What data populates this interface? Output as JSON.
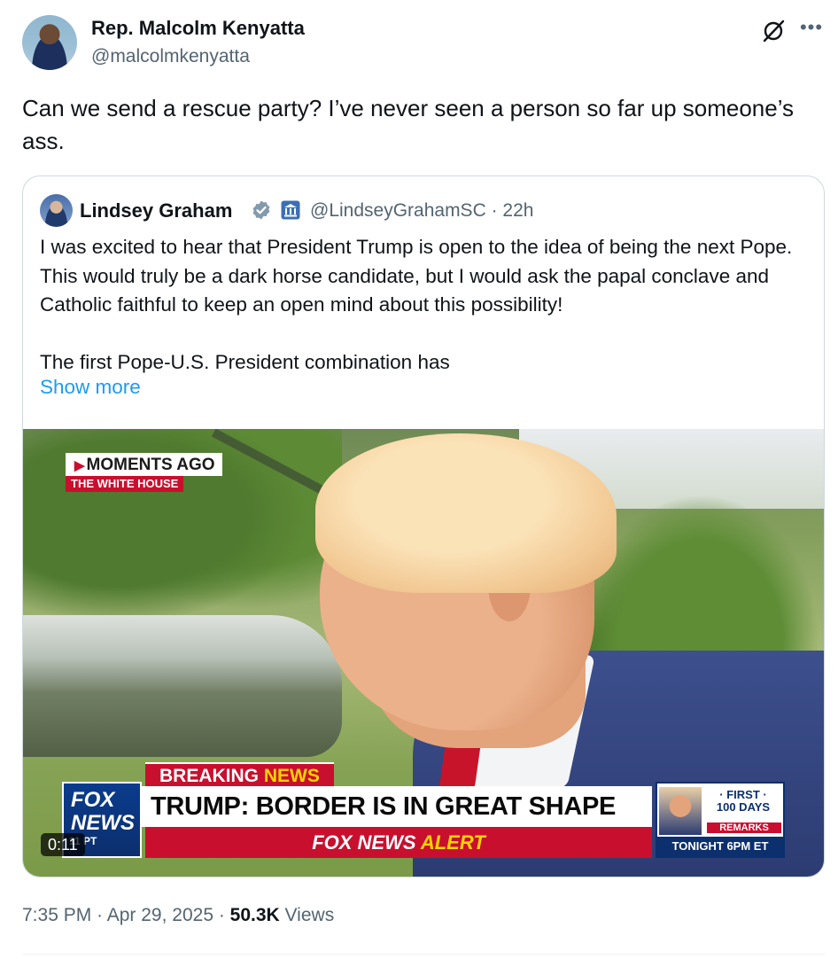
{
  "tweet": {
    "author_name": "Rep. Malcolm Kenyatta",
    "author_handle": "@malcolmkenyatta",
    "text": "Can we send a rescue party? I’ve never seen a person so far up someone’s ass.",
    "icons": [
      "grok-icon",
      "more-icon"
    ],
    "time": "7:35 PM",
    "sep1": " · ",
    "date": "Apr 29, 2025",
    "sep2": " · ",
    "views_count": "50.3K",
    "views_label": " Views"
  },
  "quote": {
    "author_name": "Lindsey Graham",
    "author_handle": "@LindseyGrahamSC",
    "age": "22h",
    "sep": " · ",
    "text": "I was excited to hear that President Trump is open to the idea of being the next Pope. This would truly be a dark horse candidate, but I would ask the papal conclave and Catholic faithful to keep an open mind about this possibility!\n\nThe first Pope-U.S. President combination has",
    "show_more": "Show more",
    "icons": [
      "verified-badge-icon",
      "government-building-icon"
    ],
    "video": {
      "duration": "0:11",
      "moments_ago": "MOMENTS AGO",
      "location": "THE WHITE HOUSE",
      "breaking_a": "BREAKING ",
      "breaking_b": "NEWS",
      "headline": "TRUMP: BORDER IS IN GREAT SHAPE",
      "alert_a": "FOX NEWS ",
      "alert_b": "ALERT",
      "logo_line1": "FOX",
      "logo_line2": "NEWS",
      "logo_pt": "11 PT",
      "promo_first": "· FIRST ·",
      "promo_days": "100 DAYS",
      "promo_remarks": "REMARKS",
      "promo_time": "TONIGHT 6PM ET"
    }
  },
  "colors": {
    "text_primary": "#0f1419",
    "text_secondary": "#536471",
    "link": "#1d9bf0",
    "border": "#cfd9de",
    "verified": "#829aab",
    "fox_red": "#c8102e",
    "fox_blue": "#0c2f6e"
  }
}
